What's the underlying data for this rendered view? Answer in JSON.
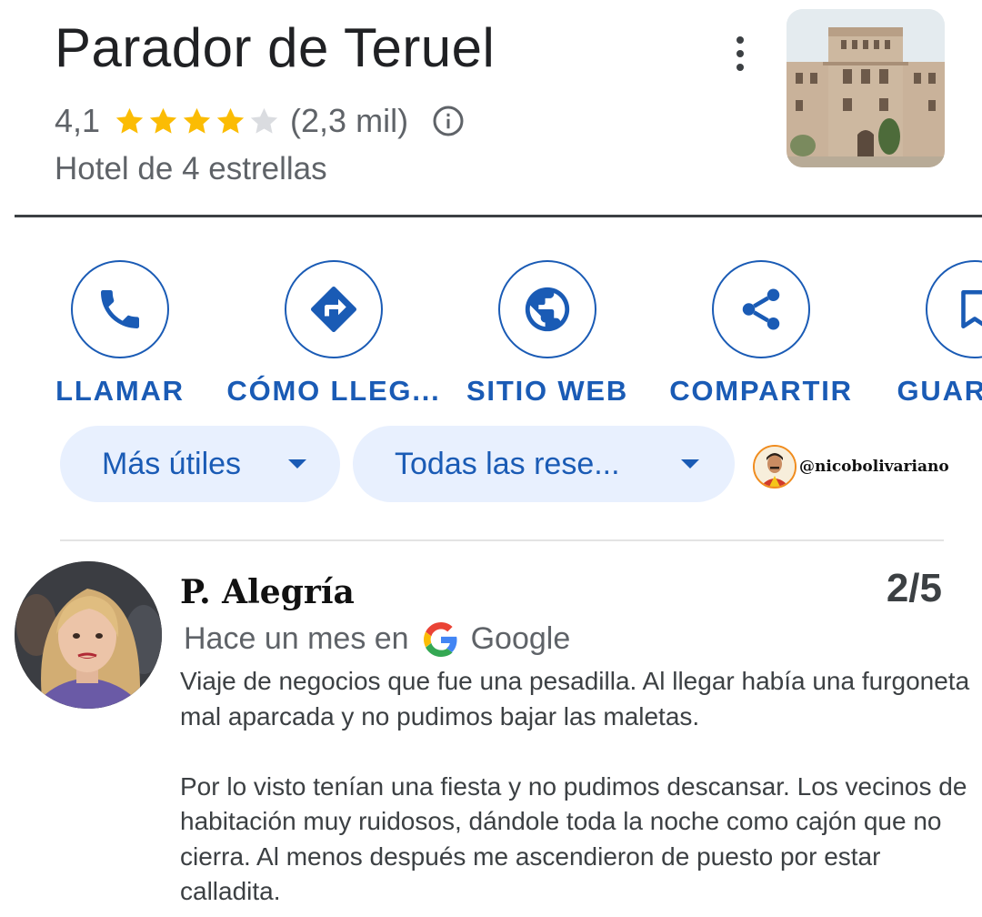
{
  "place": {
    "name": "Parador de Teruel",
    "rating": "4,1",
    "stars_filled": 4,
    "stars_total": 5,
    "review_count": "(2,3 mil)",
    "category": "Hotel de 4 estrellas"
  },
  "icons": {
    "more": "more-vert-icon",
    "info": "info-icon",
    "call": "phone-icon",
    "directions": "directions-icon",
    "website": "globe-icon",
    "share": "share-icon",
    "save": "bookmark-icon",
    "google": "google-g-icon"
  },
  "actions": [
    {
      "label": "LLAMAR"
    },
    {
      "label": "CÓMO LLEG..."
    },
    {
      "label": "SITIO WEB"
    },
    {
      "label": "COMPARTIR"
    },
    {
      "label": "GUARDAR"
    }
  ],
  "filters": {
    "sort_label": "Más útiles",
    "scope_label": "Todas las rese..."
  },
  "watermark": {
    "handle": "@nicobolivariano"
  },
  "review": {
    "author": "P. Alegría",
    "score": "2/5",
    "time": "Hace un mes en",
    "source": "Google",
    "paragraph_1": "Viaje de negocios que fue una pesadilla. Al llegar había una furgoneta mal aparcada y no pudimos bajar las maletas.",
    "paragraph_2": "Por lo visto tenían una fiesta y no pudimos descansar. Los vecinos de habitación muy ruidosos, dándole toda la noche como cajón que no cierra. Al menos después me ascendieron de puesto por estar calladita."
  },
  "colors": {
    "accent": "#1a5bb5",
    "chip_bg": "#e8f0fe",
    "star": "#fbbc04",
    "star_empty": "#dadce0",
    "text_secondary": "#5f6368"
  }
}
